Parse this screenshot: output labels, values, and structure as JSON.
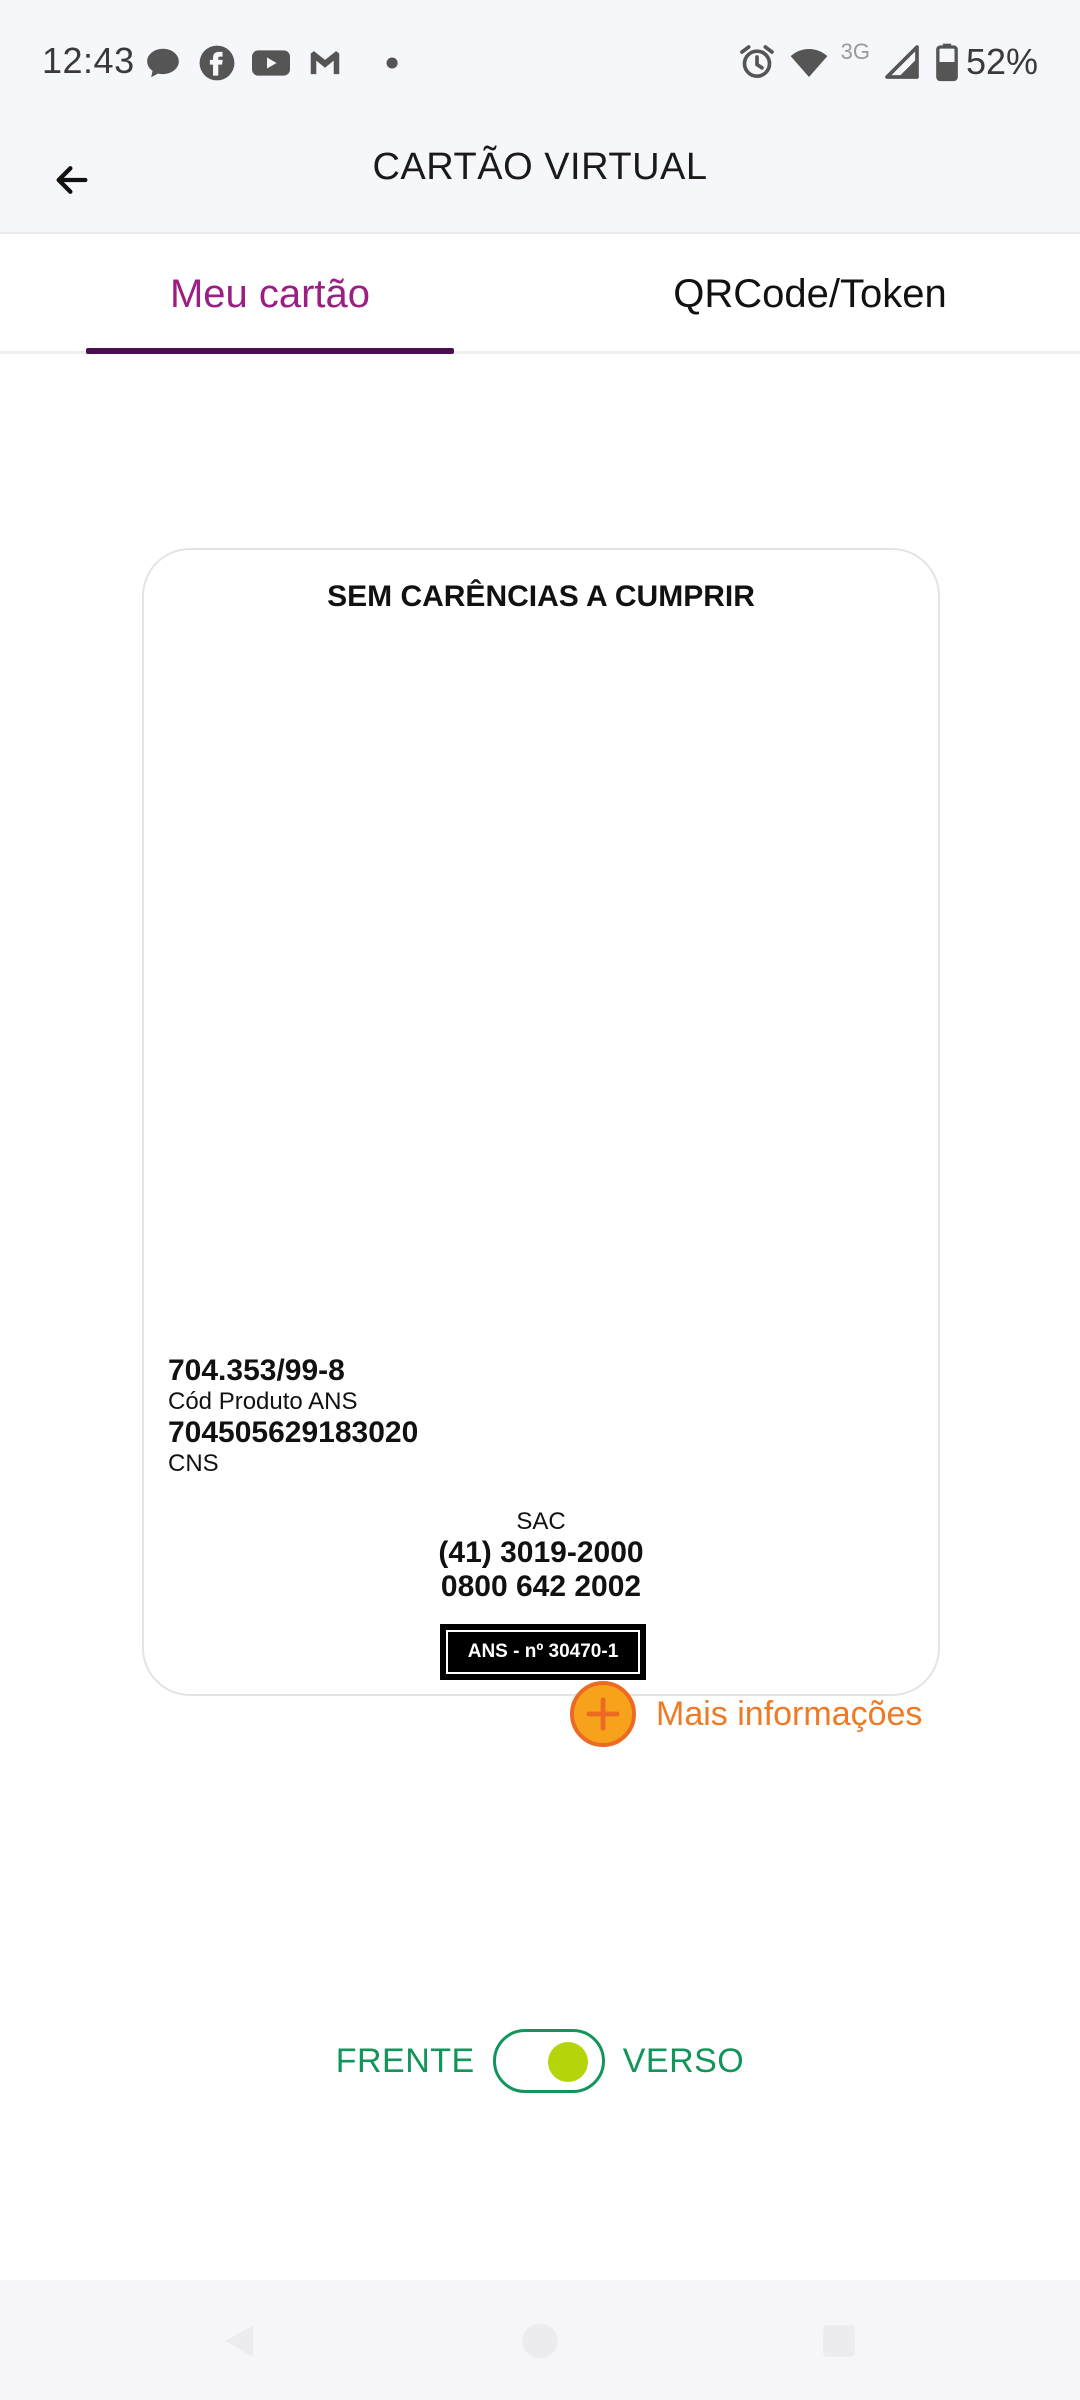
{
  "status_bar": {
    "time": "12:43",
    "notification_icons": [
      "chat-icon",
      "facebook-icon",
      "youtube-icon",
      "gmail-icon",
      "dot-icon"
    ],
    "network": "3G",
    "battery": "52%"
  },
  "app_bar": {
    "title": "CARTÃO VIRTUAL",
    "back_icon": "arrow-left-icon"
  },
  "tabs": [
    {
      "label": "Meu cartão",
      "active": true
    },
    {
      "label": "QRCode/Token",
      "active": false
    }
  ],
  "card": {
    "title": "SEM CARÊNCIAS A CUMPRIR",
    "product_code": "704.353/99-8",
    "product_code_label": "Cód Produto ANS",
    "cns": "704505629183020",
    "cns_label": "CNS",
    "sac_label": "SAC",
    "sac_phone_1": "(41) 3019-2000",
    "sac_phone_2": "0800 642 2002",
    "ans_badge": "ANS - nº 30470-1"
  },
  "more_info": {
    "label": "Mais informações",
    "icon": "plus-circle-icon"
  },
  "toggle": {
    "left_label": "FRENTE",
    "right_label": "VERSO",
    "state": "VERSO"
  },
  "colors": {
    "tab_active": "#9b1f83",
    "tab_indicator": "#4a0f4f",
    "accent_orange": "#ee7a25",
    "toggle_green": "#11955a",
    "toggle_knob": "#b5d40a"
  }
}
